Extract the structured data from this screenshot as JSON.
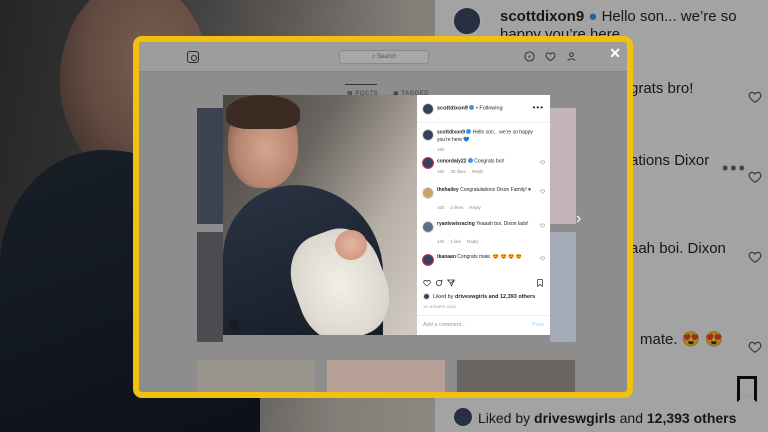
{
  "background": {
    "lines": [
      {
        "user": "scottdixon9",
        "text": "Hello son... we’re so"
      },
      {
        "text": "happy you’re here"
      },
      {
        "text": "grats bro!"
      },
      {
        "text": "ations Dixor"
      },
      {
        "text": "aah boi. Dixon"
      },
      {
        "text": "mate. 😍 😍"
      }
    ],
    "liked_by_prefix": "Liked by",
    "liked_by_user": "driveswɡirls",
    "liked_by_and": "and",
    "liked_by_count": "12,393 others"
  },
  "instagram": {
    "search_placeholder": "⌕ Search",
    "tabs": [
      "▦ POSTS",
      "▣ TAGGED"
    ],
    "close": "✕",
    "next": "›",
    "post": {
      "author": "scottdixon9",
      "follow_text": "• Following",
      "more": "•••",
      "caption": "Hello son... we’re so happy you’re here 💙",
      "caption_time": "16h",
      "comments": [
        {
          "user": "conordaly22",
          "text": "Congrats bro!",
          "time": "16h",
          "likes": "30 likes",
          "reply": "Reply"
        },
        {
          "user": "thehailey",
          "text": "Congratulations Dixon Family! ♥",
          "time": "10h",
          "likes": "2 likes",
          "reply": "Reply"
        },
        {
          "user": "ryanlewisracing",
          "text": "Yeaaah boi. Dixon lads!",
          "time": "12h",
          "likes": "1 like",
          "reply": "Reply"
        },
        {
          "user": "tkanaan",
          "text": "Congrats mate. 😍 😍 😍 😍",
          "time": "",
          "likes": "",
          "reply": ""
        }
      ],
      "liked_by_prefix": "Liked by",
      "liked_by_user": "driveswɡirls",
      "liked_by_count": "and 12,393 others",
      "time_ago": "16 HOURS AGO",
      "add_comment_placeholder": "Add a comment...",
      "post_button": "Post"
    }
  },
  "colors": {
    "frame": "#f2c10f",
    "verified": "#3897f0"
  }
}
